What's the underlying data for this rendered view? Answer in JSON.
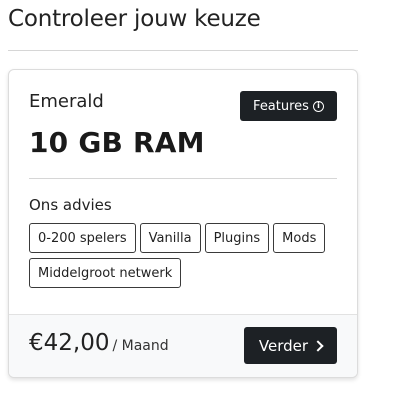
{
  "header": {
    "title": "Controleer jouw keuze"
  },
  "plan": {
    "name": "Emerald",
    "features_label": "Features",
    "ram": "10 GB RAM",
    "advice_label": "Ons advies",
    "tags": [
      "0-200 spelers",
      "Vanilla",
      "Plugins",
      "Mods",
      "Middelgroot netwerk"
    ]
  },
  "footer": {
    "price": "€42,00",
    "period": "/ Maand",
    "next_label": "Verder"
  },
  "icons": {
    "features": "info-icon",
    "next": "chevron-right-icon"
  },
  "colors": {
    "button_bg": "#1d2125",
    "footer_bg": "#f8f9fa"
  }
}
